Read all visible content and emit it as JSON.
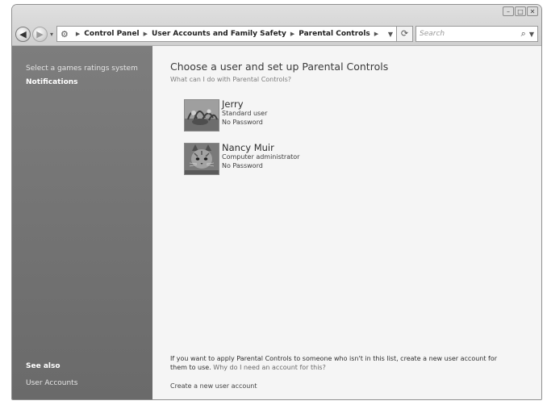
{
  "window": {
    "buttons": {
      "minimize": "–",
      "maximize": "□",
      "close": "✕"
    }
  },
  "nav": {
    "back": "◀",
    "forward": "▶",
    "breadcrumbs": [
      "Control Panel",
      "User Accounts and Family Safety",
      "Parental Controls"
    ],
    "search_placeholder": "Search"
  },
  "sidebar": {
    "top_links": [
      "Select a games ratings system",
      "Notifications"
    ],
    "see_also_heading": "See also",
    "see_also_links": [
      "User Accounts"
    ]
  },
  "main": {
    "heading": "Choose a user and set up Parental Controls",
    "help_link": "What can I do with Parental Controls?",
    "users": [
      {
        "name": "Jerry",
        "type": "Standard user",
        "password": "No Password",
        "avatar": "plant-picture"
      },
      {
        "name": "Nancy Muir",
        "type": "Computer administrator",
        "password": "No Password",
        "avatar": "kitten-picture"
      }
    ],
    "footer_text": "If you want to apply Parental Controls to someone who isn't in this list, create a new user account for them to use.",
    "footer_link": "Why do I need an account for this?",
    "create_link": "Create a new user account"
  },
  "colors": {
    "sidebar": "#727272",
    "content": "#f5f5f5",
    "window_frame": "#cfcfcf"
  }
}
